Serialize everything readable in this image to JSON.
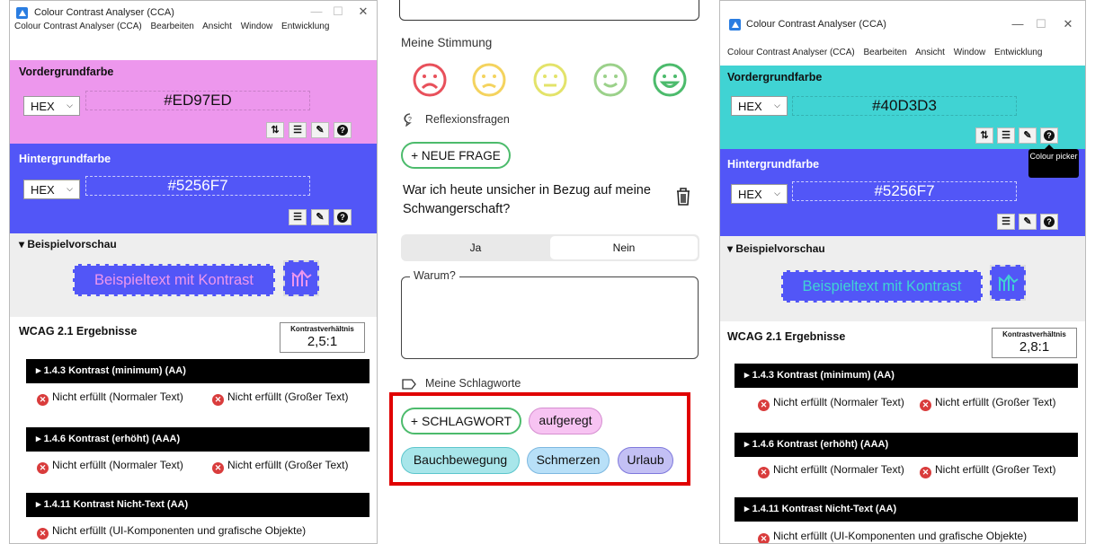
{
  "left_window": {
    "title": "Colour Contrast Analyser (CCA)",
    "controls": {
      "minimize": "—",
      "maximize": "☐",
      "close": "✕"
    },
    "menu": [
      "Colour Contrast Analyser (CCA)",
      "Bearbeiten",
      "Ansicht",
      "Window",
      "Entwicklung"
    ],
    "foreground": {
      "label": "Vordergrundfarbe",
      "format": "HEX",
      "value": "#ED97ED",
      "color": "#ED97ED"
    },
    "background": {
      "label": "Hintergrundfarbe",
      "format": "HEX",
      "value": "#5256F7",
      "color": "#5256F7"
    },
    "preview": {
      "label": "▾ Beispielvorschau",
      "sample_text": "Beispieltext mit Kontrast"
    },
    "wcag": {
      "title": "WCAG 2.1 Ergebnisse",
      "ratio_label": "Kontrastverhältnis",
      "ratio": "2,5:1"
    },
    "criteria": [
      {
        "title": "▸ 1.4.3 Kontrast (minimum) (AA)",
        "results": [
          "Nicht erfüllt (Normaler Text)",
          "Nicht erfüllt (Großer Text)"
        ]
      },
      {
        "title": "▸ 1.4.6 Kontrast (erhöht) (AAA)",
        "results": [
          "Nicht erfüllt (Normaler Text)",
          "Nicht erfüllt (Großer Text)"
        ]
      },
      {
        "title": "▸ 1.4.11 Kontrast Nicht-Text (AA)",
        "results": [
          "Nicht erfüllt (UI-Komponenten und grafische Objekte)"
        ]
      }
    ]
  },
  "right_window": {
    "title": "Colour Contrast Analyser (CCA)",
    "controls": {
      "minimize": "—",
      "maximize": "☐",
      "close": "✕"
    },
    "menu": [
      "Colour Contrast Analyser (CCA)",
      "Bearbeiten",
      "Ansicht",
      "Window",
      "Entwicklung"
    ],
    "foreground": {
      "label": "Vordergrundfarbe",
      "format": "HEX",
      "value": "#40D3D3",
      "color": "#40D3D3"
    },
    "background": {
      "label": "Hintergrundfarbe",
      "format": "HEX",
      "value": "#5256F7",
      "color": "#5256F7"
    },
    "tooltip": "Colour picker",
    "preview": {
      "label": "▾ Beispielvorschau",
      "sample_text": "Beispieltext mit Kontrast"
    },
    "wcag": {
      "title": "WCAG 2.1 Ergebnisse",
      "ratio_label": "Kontrastverhältnis",
      "ratio": "2,8:1"
    },
    "criteria": [
      {
        "title": "▸ 1.4.3 Kontrast (minimum) (AA)",
        "results": [
          "Nicht erfüllt (Normaler Text)",
          "Nicht erfüllt (Großer Text)"
        ]
      },
      {
        "title": "▸ 1.4.6 Kontrast (erhöht) (AAA)",
        "results": [
          "Nicht erfüllt (Normaler Text)",
          "Nicht erfüllt (Großer Text)"
        ]
      },
      {
        "title": "▸ 1.4.11 Kontrast Nicht-Text (AA)",
        "results": [
          "Nicht erfüllt (UI-Komponenten und grafische Objekte)"
        ]
      }
    ]
  },
  "app": {
    "mood_label": "Meine Stimmung",
    "mood_colors": [
      "#E8505B",
      "#F4D35E",
      "#E3E36A",
      "#9BD18A",
      "#4CBB6C"
    ],
    "reflection_label": "Reflexionsfragen",
    "new_question": "+ NEUE FRAGE",
    "question": "War ich heute unsicher in Bezug auf meine Schwangerschaft?",
    "answer_yes": "Ja",
    "answer_no": "Nein",
    "why_label": "Warum?",
    "tags_label": "Meine Schlagworte",
    "add_tag": "+ SCHLAGWORT",
    "tags": [
      {
        "label": "aufgeregt",
        "bg": "#F7C3F2",
        "border": "#D58ED0"
      },
      {
        "label": "Bauchbewegung",
        "bg": "#A8E6EA",
        "border": "#5CC6CC"
      },
      {
        "label": "Schmerzen",
        "bg": "#B8E0F8",
        "border": "#7DB8E0"
      },
      {
        "label": "Urlaub",
        "bg": "#C3C0F4",
        "border": "#7E78DC"
      }
    ],
    "highlight_color": "#E00000"
  }
}
